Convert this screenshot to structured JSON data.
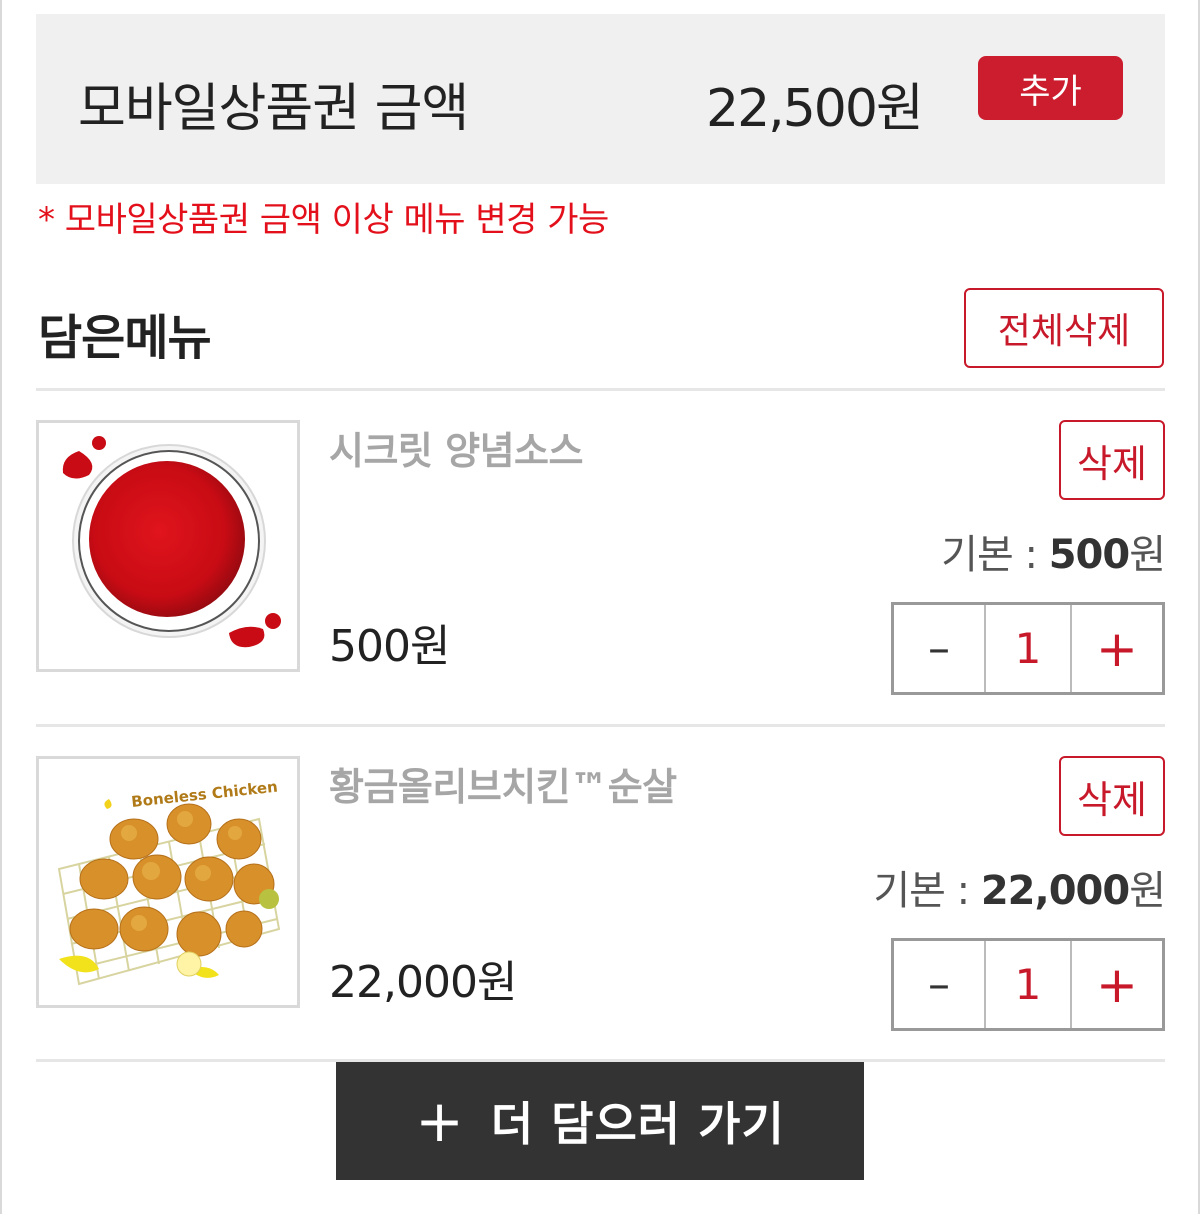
{
  "voucher": {
    "label": "모바일상품권 금액",
    "amount": "22,500원",
    "add_label": "추가",
    "notice": "* 모바일상품권 금액 이상 메뉴 변경 가능"
  },
  "cart": {
    "title": "담은메뉴",
    "clear_all_label": "전체삭제",
    "items": [
      {
        "name": "시크릿 양념소스",
        "price": "500원",
        "delete_label": "삭제",
        "base_label": "기본 : ",
        "base_price": "500",
        "base_unit": "원",
        "minus": "–",
        "qty": "1",
        "plus": "+"
      },
      {
        "name": "황금올리브치킨™순살",
        "price": "22,000원",
        "delete_label": "삭제",
        "base_label": "기본 : ",
        "base_price": "22,000",
        "base_unit": "원",
        "minus": "–",
        "qty": "1",
        "plus": "+",
        "image_text": "Boneless Chicken"
      }
    ]
  },
  "more_button": {
    "plus": "+",
    "label": "더 담으러 가기"
  },
  "colors": {
    "accent": "#cc1d2f",
    "notice": "#e3101b",
    "dark_button": "#333333"
  }
}
